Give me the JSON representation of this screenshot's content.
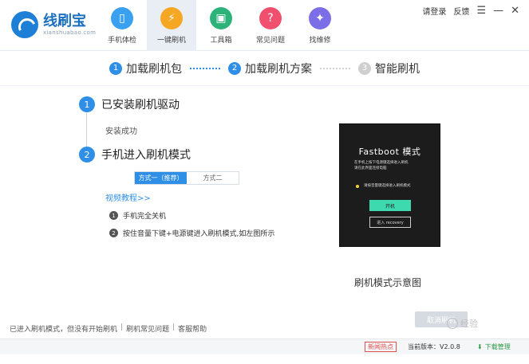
{
  "app": {
    "title": "线刷宝",
    "subtitle": "xianshuabao.com"
  },
  "nav": [
    {
      "label": "手机体检",
      "icon": "phone-check-icon",
      "color": "#3aa0f0",
      "glyph": "📱"
    },
    {
      "label": "一键刷机",
      "icon": "flash-icon",
      "color": "#f5a623",
      "glyph": "⚡"
    },
    {
      "label": "工具箱",
      "icon": "toolbox-icon",
      "color": "#2db37a",
      "glyph": "▣"
    },
    {
      "label": "常见问题",
      "icon": "faq-icon",
      "color": "#f0506e",
      "glyph": "?"
    },
    {
      "label": "找维修",
      "icon": "repair-icon",
      "color": "#7b6ee6",
      "glyph": "✦"
    }
  ],
  "topbar": {
    "login": "请登录",
    "feedback": "反馈"
  },
  "steps": [
    {
      "num": "1",
      "label": "加载刷机包"
    },
    {
      "num": "2",
      "label": "加载刷机方案"
    },
    {
      "num": "3",
      "label": "智能刷机"
    }
  ],
  "phases": {
    "p1": {
      "num": "1",
      "label": "已安装刷机驱动",
      "sub": "安装成功"
    },
    "p2": {
      "num": "2",
      "label": "手机进入刷机模式"
    }
  },
  "method_tabs": {
    "tab1": "方式一（推荐）",
    "tab2": "方式二"
  },
  "video_link": "视频教程>>",
  "instructions": [
    {
      "num": "1",
      "text": "手机完全关机"
    },
    {
      "num": "2",
      "text": "按住音量下键+电源键进入刷机模式,如左图所示"
    }
  ],
  "phone": {
    "title": "Fastboot 模式",
    "line1": "在手机上按下电源键选择进入刷机",
    "line2": "请在此界面连接电脑",
    "bullet": "请按音量键选择进入刷机模式",
    "btn1": "开机",
    "btn2": "进入 recovery",
    "caption": "刷机模式示意图"
  },
  "cancel_button": "取消刷机",
  "watermark": "经验",
  "bottom_links": [
    "已进入刷机模式，但没有开始刷机",
    "刷机常见问题",
    "客服帮助"
  ],
  "status": {
    "hot": "新闻热点",
    "version": "当前版本：V2.0.8",
    "download": "下载管理"
  }
}
